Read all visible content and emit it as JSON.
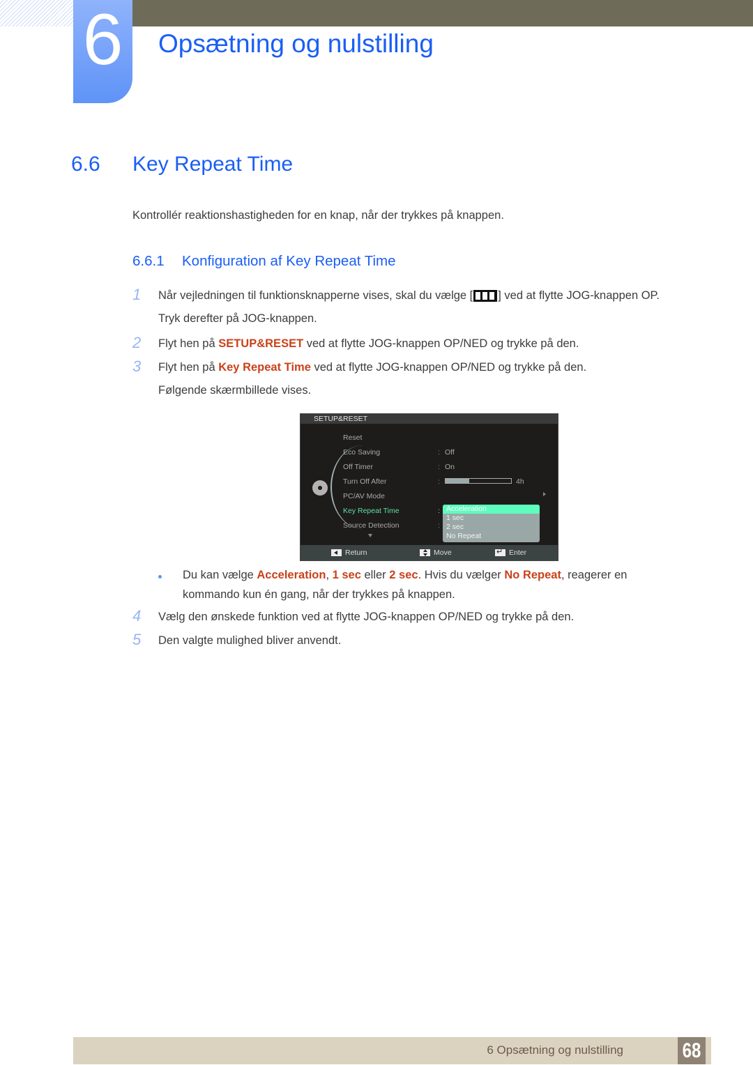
{
  "header": {
    "chapter_number": "6",
    "chapter_title": "Opsætning og nulstilling",
    "colors": {
      "accent_blue": "#1a5ef5",
      "top_bar": "#6e6c58",
      "highlight": "#c8421a"
    }
  },
  "section": {
    "number": "6.6",
    "title": "Key Repeat Time",
    "intro": "Kontrollér reaktionshastigheden for en knap, når der trykkes på knappen."
  },
  "subsection": {
    "number": "6.6.1",
    "title": "Konfiguration af Key Repeat Time"
  },
  "steps": [
    {
      "n": "1",
      "before_icon": "Når vejledningen til funktionsknapperne vises, skal du vælge [",
      "icon": "menu-icon",
      "after_icon": "] ved at flytte JOG-knappen OP.",
      "line2": "Tryk derefter på JOG-knappen."
    },
    {
      "n": "2",
      "pre": "Flyt hen på ",
      "highlight": "SETUP&RESET",
      "post": " ved at flytte JOG-knappen OP/NED og trykke på den."
    },
    {
      "n": "3",
      "pre": "Flyt hen på ",
      "highlight": "Key Repeat Time",
      "post": " ved at flytte JOG-knappen OP/NED og trykke på den.",
      "line2": "Følgende skærmbillede vises."
    },
    {
      "n": "4",
      "text": "Vælg den ønskede funktion ved at flytte JOG-knappen OP/NED og trykke på den."
    },
    {
      "n": "5",
      "text": "Den valgte mulighed bliver anvendt."
    }
  ],
  "osd": {
    "title": "SETUP&RESET",
    "icon": "gear-icon",
    "items": [
      {
        "label": "Reset",
        "value": ""
      },
      {
        "label": "Eco Saving",
        "value": "Off"
      },
      {
        "label": "Off Timer",
        "value": "On"
      },
      {
        "label": "Turn Off After",
        "value": "4h",
        "slider_fraction": 0.36
      },
      {
        "label": "PC/AV Mode",
        "value": ""
      },
      {
        "label": "Key Repeat Time",
        "value": "",
        "active": true
      },
      {
        "label": "Source Detection",
        "value": ""
      }
    ],
    "dropdown_options": [
      "Acceleration",
      "1 sec",
      "2 sec",
      "No Repeat"
    ],
    "selected_option": "Acceleration",
    "footer": {
      "return": "Return",
      "move": "Move",
      "enter": "Enter"
    },
    "colors": {
      "active_item": "#5ce0a0",
      "selected_option_bg": "#5efcbd",
      "dropdown_bg": "#99a7a6"
    }
  },
  "note": {
    "p1": "Du kan vælge ",
    "h1": "Acceleration",
    "p2": ", ",
    "h2": "1 sec",
    "p3": " eller ",
    "h3": "2 sec",
    "p4": ". Hvis du vælger ",
    "h4": "No Repeat",
    "p5": ", reagerer en kommando kun én gang, når der trykkes på knappen."
  },
  "footer": {
    "chapter_label": "6 Opsætning og nulstilling",
    "page_number": "68"
  }
}
